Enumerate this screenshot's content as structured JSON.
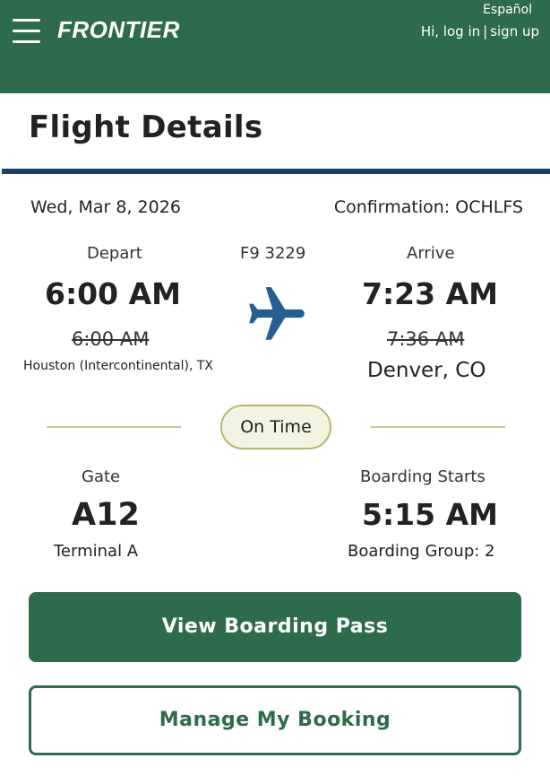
{
  "header": {
    "logo": "FRONTIER",
    "language_link": "Español",
    "login_label": "Hi, log in",
    "login_separator": "|",
    "signup_label": "sign up"
  },
  "page": {
    "title": "Flight Details"
  },
  "flight": {
    "date": "Wed, Mar 8, 2026",
    "confirmation": "Confirmation: OCHLFS",
    "flight_number": "F9 3229",
    "depart": {
      "label": "Depart",
      "time": "6:00 AM",
      "original_time": "6:00 AM",
      "city": "Houston (Intercontinental), TX"
    },
    "arrive": {
      "label": "Arrive",
      "time": "7:23 AM",
      "original_time": "7:36 AM",
      "city": "Denver, CO"
    },
    "status": "On Time",
    "gate": {
      "label": "Gate",
      "value": "A12",
      "terminal": "Terminal A"
    },
    "boarding": {
      "label": "Boarding Starts",
      "time": "5:15 AM",
      "group": "Boarding Group: 2"
    }
  },
  "actions": {
    "view_boarding_pass": "View Boarding Pass",
    "manage_booking": "Manage My Booking"
  },
  "colors": {
    "brand_green": "#2e6b4b",
    "title_rule": "#1e3f66",
    "plane_icon": "#245f8f",
    "status_border": "#b8b76c"
  },
  "icons": {
    "menu": "hamburger-menu-icon",
    "flight": "airplane-icon"
  }
}
